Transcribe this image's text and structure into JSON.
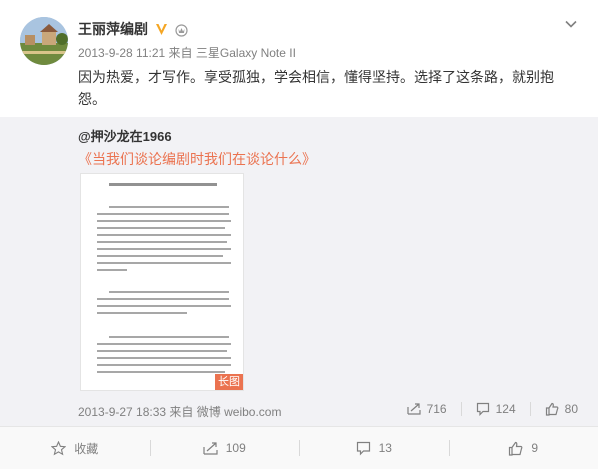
{
  "post": {
    "author": "王丽萍编剧",
    "time": "2013-9-28 11:21",
    "source_prefix": "来自",
    "source": "三星Galaxy Note II",
    "text": "因为热爱，才写作。享受孤独，学会相信，懂得坚持。选择了这条路，就别抱怨。"
  },
  "repost": {
    "author": "@押沙龙在1966",
    "title": "《当我们谈论编剧时我们在谈论什么》",
    "image_tag": "长图",
    "time": "2013-9-27 18:33",
    "source_prefix": "来自",
    "source": "微博 weibo.com",
    "reposts": "716",
    "comments": "124",
    "likes": "80"
  },
  "actions": {
    "favorite": "收藏",
    "repost": "109",
    "comment": "13",
    "like": "9"
  },
  "colors": {
    "link": "#eb7350",
    "verified": "#f5a623",
    "muted": "#808080",
    "repost_bg": "#f2f2f5"
  }
}
